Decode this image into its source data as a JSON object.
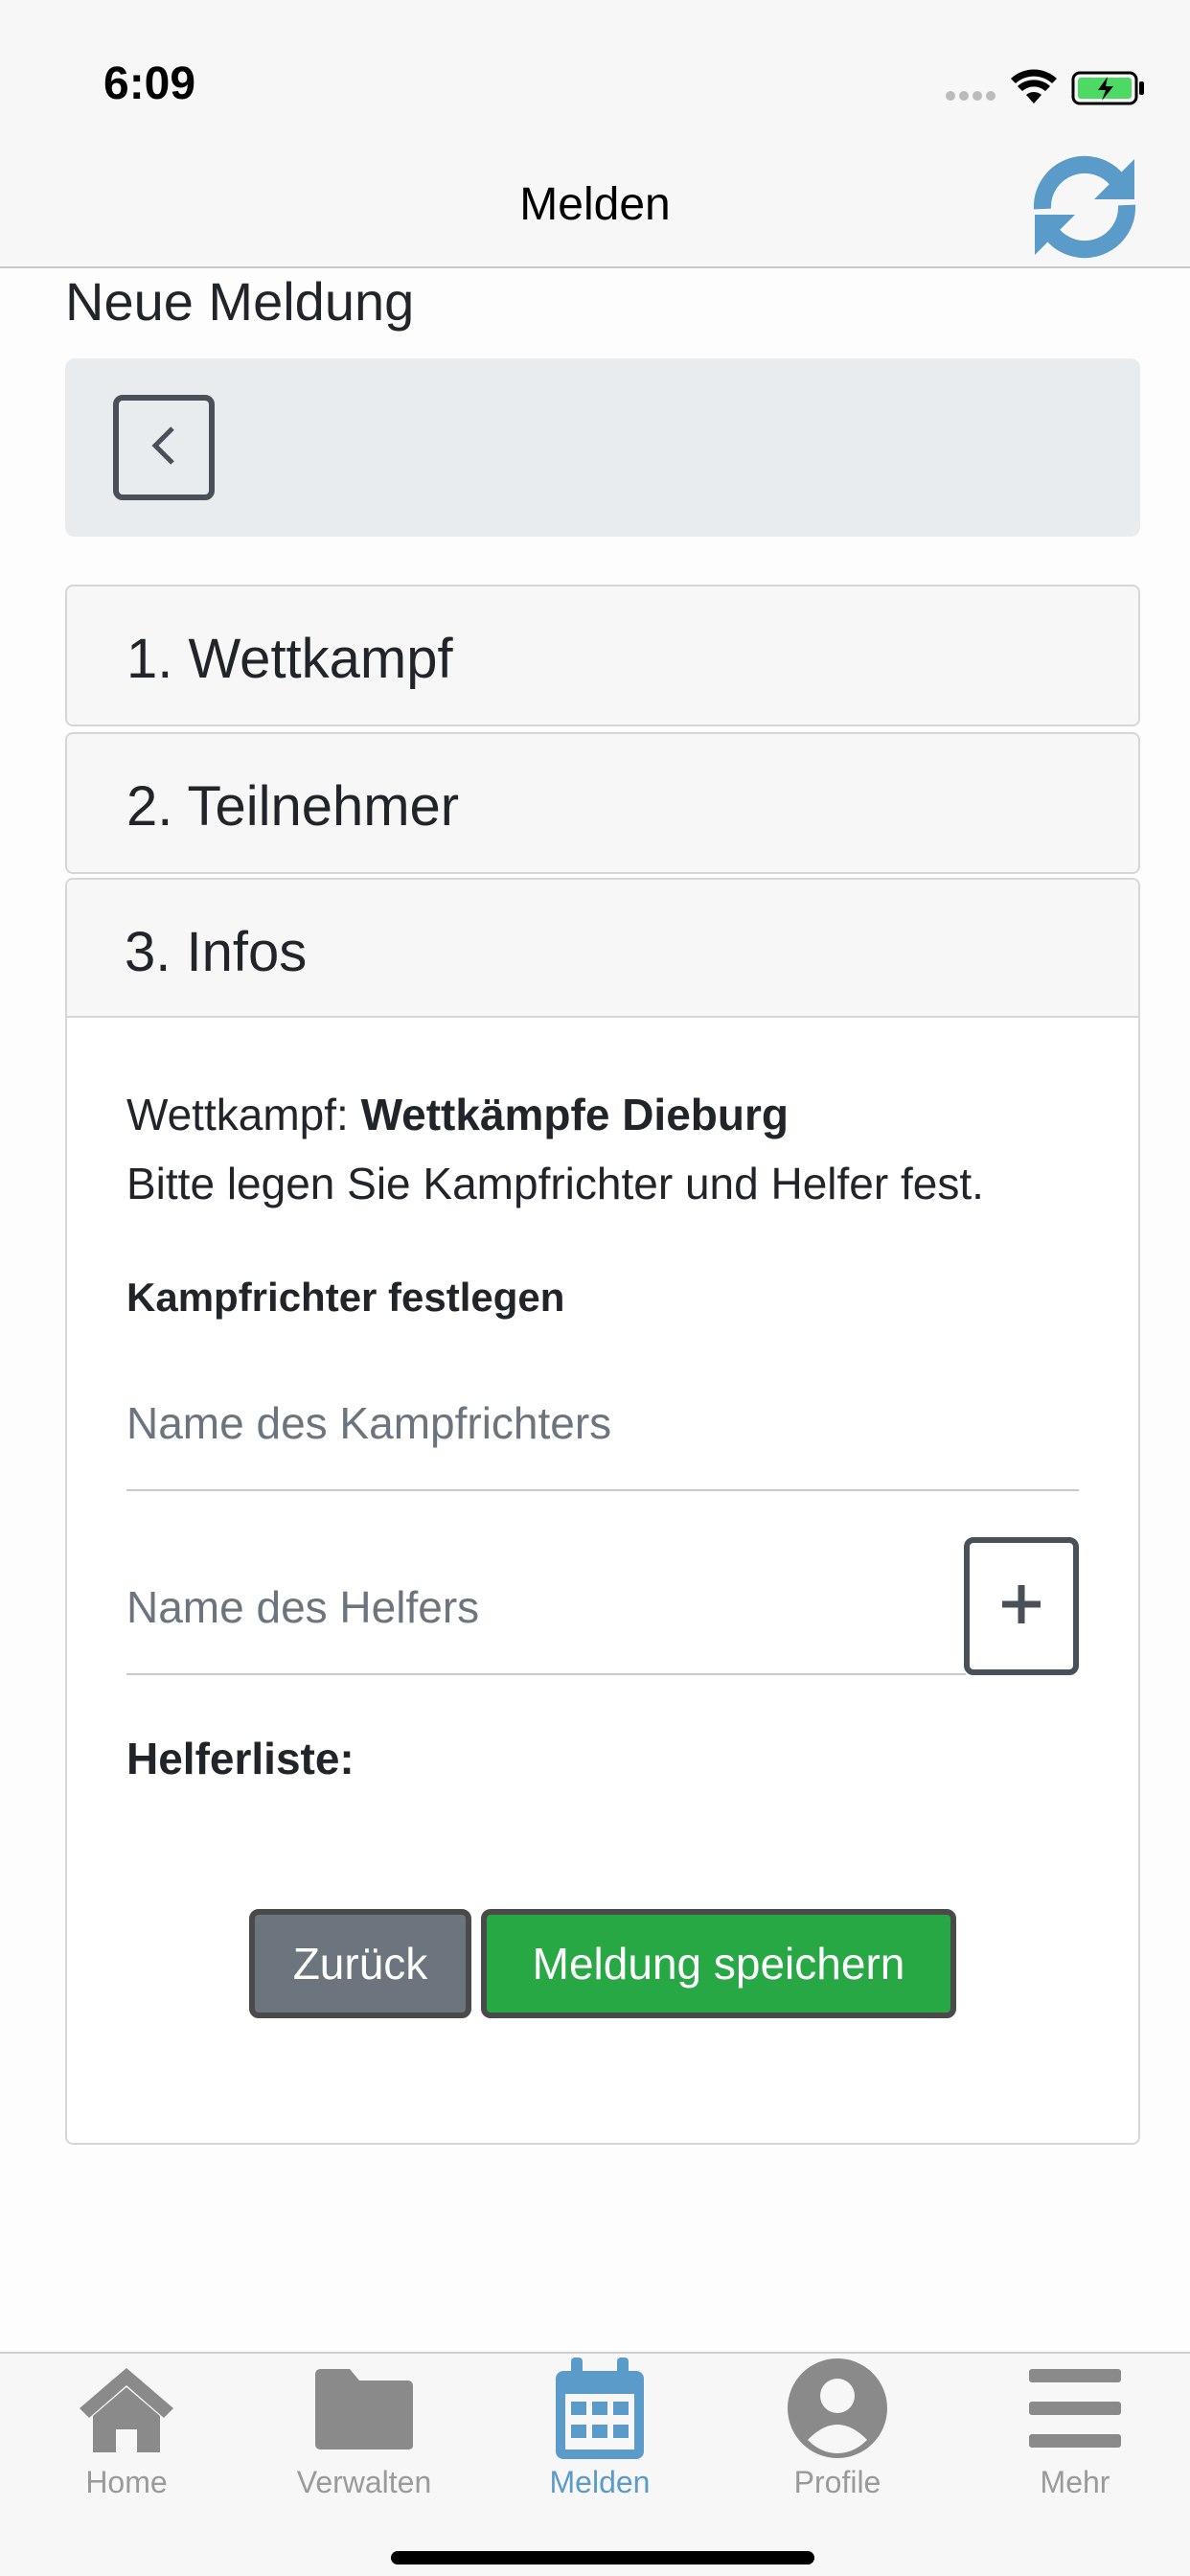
{
  "status_bar": {
    "time": "6:09"
  },
  "nav": {
    "title": "Melden"
  },
  "page": {
    "title": "Neue Meldung"
  },
  "accordion": {
    "step1": "1. Wettkampf",
    "step2": "2. Teilnehmer",
    "step3": "3. Infos"
  },
  "infos": {
    "competition_label": "Wettkampf:",
    "competition_name": "Wettkämpfe Dieburg",
    "instruction": "Bitte legen Sie Kampfrichter und Helfer fest.",
    "judge_heading": "Kampfrichter festlegen",
    "judge_placeholder": "Name des Kampfrichters",
    "helper_placeholder": "Name des Helfers",
    "helper_list_heading": "Helferliste:",
    "back_button": "Zurück",
    "save_button": "Meldung speichern"
  },
  "tabs": [
    {
      "label": "Home",
      "icon": "home-icon"
    },
    {
      "label": "Verwalten",
      "icon": "folder-icon"
    },
    {
      "label": "Melden",
      "icon": "calendar-icon",
      "active": true
    },
    {
      "label": "Profile",
      "icon": "user-icon"
    },
    {
      "label": "Mehr",
      "icon": "menu-icon"
    }
  ],
  "colors": {
    "accent": "#5a9bc9",
    "success": "#28a745",
    "secondary": "#6c757d",
    "tab_inactive": "#9a9a9a"
  }
}
